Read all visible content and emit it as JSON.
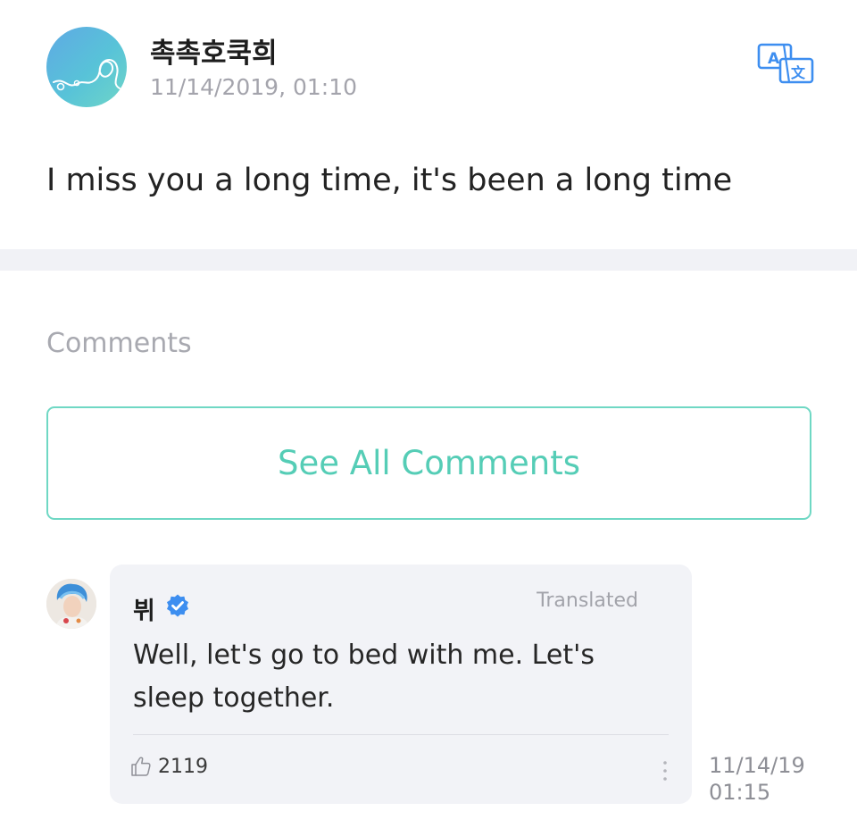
{
  "post": {
    "author": "촉촉호쿡희",
    "timestamp": "11/14/2019, 01:10",
    "body": "I miss you a long time, it's been a long time",
    "avatar_icon": "heart-swirl-avatar",
    "translate_icon": "translate-icon"
  },
  "comments": {
    "heading": "Comments",
    "see_all_label": "See All Comments",
    "items": [
      {
        "author": "뷔",
        "verified_icon": "verified-badge-icon",
        "translated_label": "Translated",
        "text": "Well, let's go to bed with me. Let's sleep together.",
        "likes": "2119",
        "like_icon": "thumbs-up-icon",
        "more_icon": "more-vertical-icon",
        "date": "11/14/19",
        "time": "01:15"
      }
    ]
  },
  "colors": {
    "accent": "#55cdb6",
    "accent_border": "#6fd8c4",
    "verified": "#3d8ef0",
    "muted_text": "#a4a4ac",
    "card_background": "#f2f3f7",
    "divider_background": "#f1f2f6"
  }
}
